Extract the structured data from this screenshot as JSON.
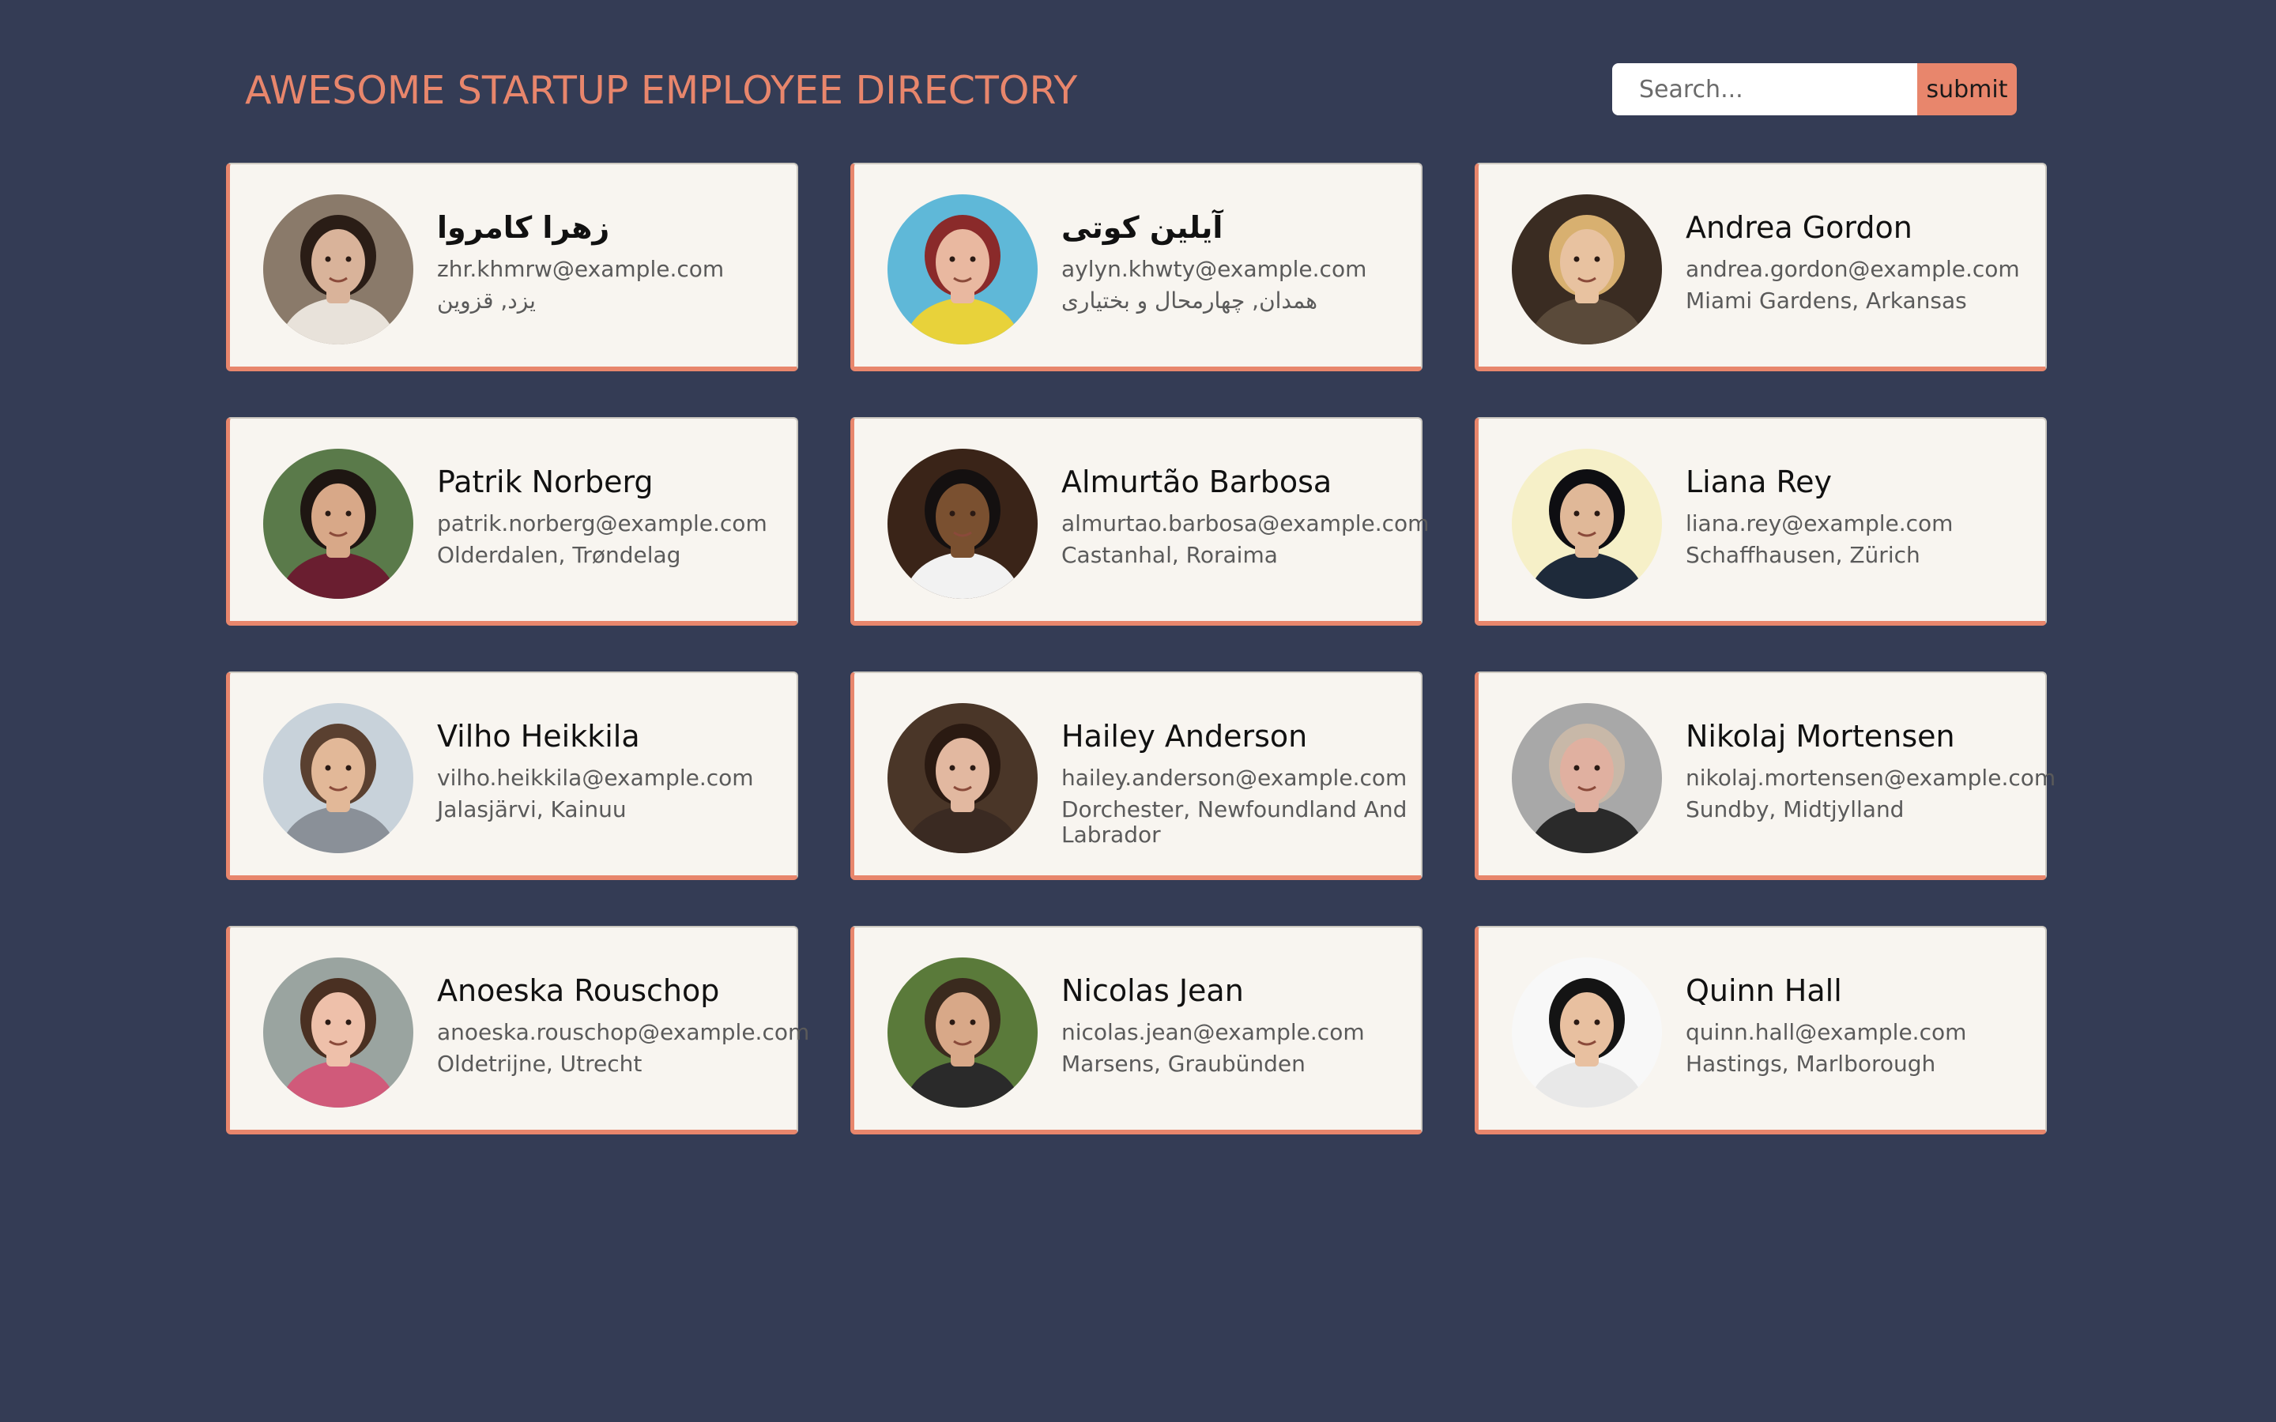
{
  "header": {
    "title": "AWESOME STARTUP EMPLOYEE DIRECTORY"
  },
  "search": {
    "placeholder": "Search...",
    "submit_label": "submit"
  },
  "colors": {
    "background": "#343c55",
    "accent": "#e8866c",
    "card": "#f8f5f0"
  },
  "employees": [
    {
      "name": "زهرا کامروا",
      "email": "zhr.khmrw@example.com",
      "location": "یزد, قزوین",
      "rtl": true,
      "avatar": {
        "bg": "#8a7a6a",
        "skin": "#d9b39a",
        "hair": "#2a1d16",
        "shirt": "#e8e2da"
      }
    },
    {
      "name": "آیلین کوتی",
      "email": "aylyn.khwty@example.com",
      "location": "همدان, چهارمحال و بختیاری",
      "rtl": true,
      "avatar": {
        "bg": "#5fb8d8",
        "skin": "#e9b8a0",
        "hair": "#8a2a2a",
        "shirt": "#e8d23a"
      }
    },
    {
      "name": "Andrea Gordon",
      "email": "andrea.gordon@example.com",
      "location": "Miami Gardens, Arkansas",
      "rtl": false,
      "avatar": {
        "bg": "#3a2c22",
        "skin": "#e8c2a0",
        "hair": "#d8b070",
        "shirt": "#5a4a3a"
      }
    },
    {
      "name": "Patrik Norberg",
      "email": "patrik.norberg@example.com",
      "location": "Olderdalen, Trøndelag",
      "rtl": false,
      "avatar": {
        "bg": "#5a7a4a",
        "skin": "#d8a888",
        "hair": "#1e1612",
        "shirt": "#6a1e30"
      }
    },
    {
      "name": "Almurtão Barbosa",
      "email": "almurtao.barbosa@example.com",
      "location": "Castanhal, Roraima",
      "rtl": false,
      "avatar": {
        "bg": "#3a2418",
        "skin": "#7a5030",
        "hair": "#141010",
        "shirt": "#f2f2f2"
      }
    },
    {
      "name": "Liana Rey",
      "email": "liana.rey@example.com",
      "location": "Schaffhausen, Zürich",
      "rtl": false,
      "avatar": {
        "bg": "#f6f0c8",
        "skin": "#e0b898",
        "hair": "#0e0e12",
        "shirt": "#1e2a3a"
      }
    },
    {
      "name": "Vilho Heikkila",
      "email": "vilho.heikkila@example.com",
      "location": "Jalasjärvi, Kainuu",
      "rtl": false,
      "avatar": {
        "bg": "#c8d2da",
        "skin": "#e2b898",
        "hair": "#5a4030",
        "shirt": "#8a9098"
      }
    },
    {
      "name": "Hailey Anderson",
      "email": "hailey.anderson@example.com",
      "location": "Dorchester, Newfoundland And Labrador",
      "rtl": false,
      "avatar": {
        "bg": "#4a3628",
        "skin": "#e2b8a0",
        "hair": "#2a1a12",
        "shirt": "#3a2a22"
      }
    },
    {
      "name": "Nikolaj Mortensen",
      "email": "nikolaj.mortensen@example.com",
      "location": "Sundby, Midtjylland",
      "rtl": false,
      "avatar": {
        "bg": "#a8a8a8",
        "skin": "#e0b0a0",
        "hair": "#c8b8a8",
        "shirt": "#2a2a2a"
      }
    },
    {
      "name": "Anoeska Rouschop",
      "email": "anoeska.rouschop@example.com",
      "location": "Oldetrijne, Utrecht",
      "rtl": false,
      "avatar": {
        "bg": "#9aa4a0",
        "skin": "#eec0aa",
        "hair": "#4a3022",
        "shirt": "#d05a7a"
      }
    },
    {
      "name": "Nicolas Jean",
      "email": "nicolas.jean@example.com",
      "location": "Marsens, Graubünden",
      "rtl": false,
      "avatar": {
        "bg": "#5a7a3a",
        "skin": "#d8a888",
        "hair": "#3a2a1e",
        "shirt": "#2a2a2a"
      }
    },
    {
      "name": "Quinn Hall",
      "email": "quinn.hall@example.com",
      "location": "Hastings, Marlborough",
      "rtl": false,
      "avatar": {
        "bg": "#f8f8f8",
        "skin": "#e8c0a0",
        "hair": "#141414",
        "shirt": "#e8e8e8"
      }
    }
  ]
}
